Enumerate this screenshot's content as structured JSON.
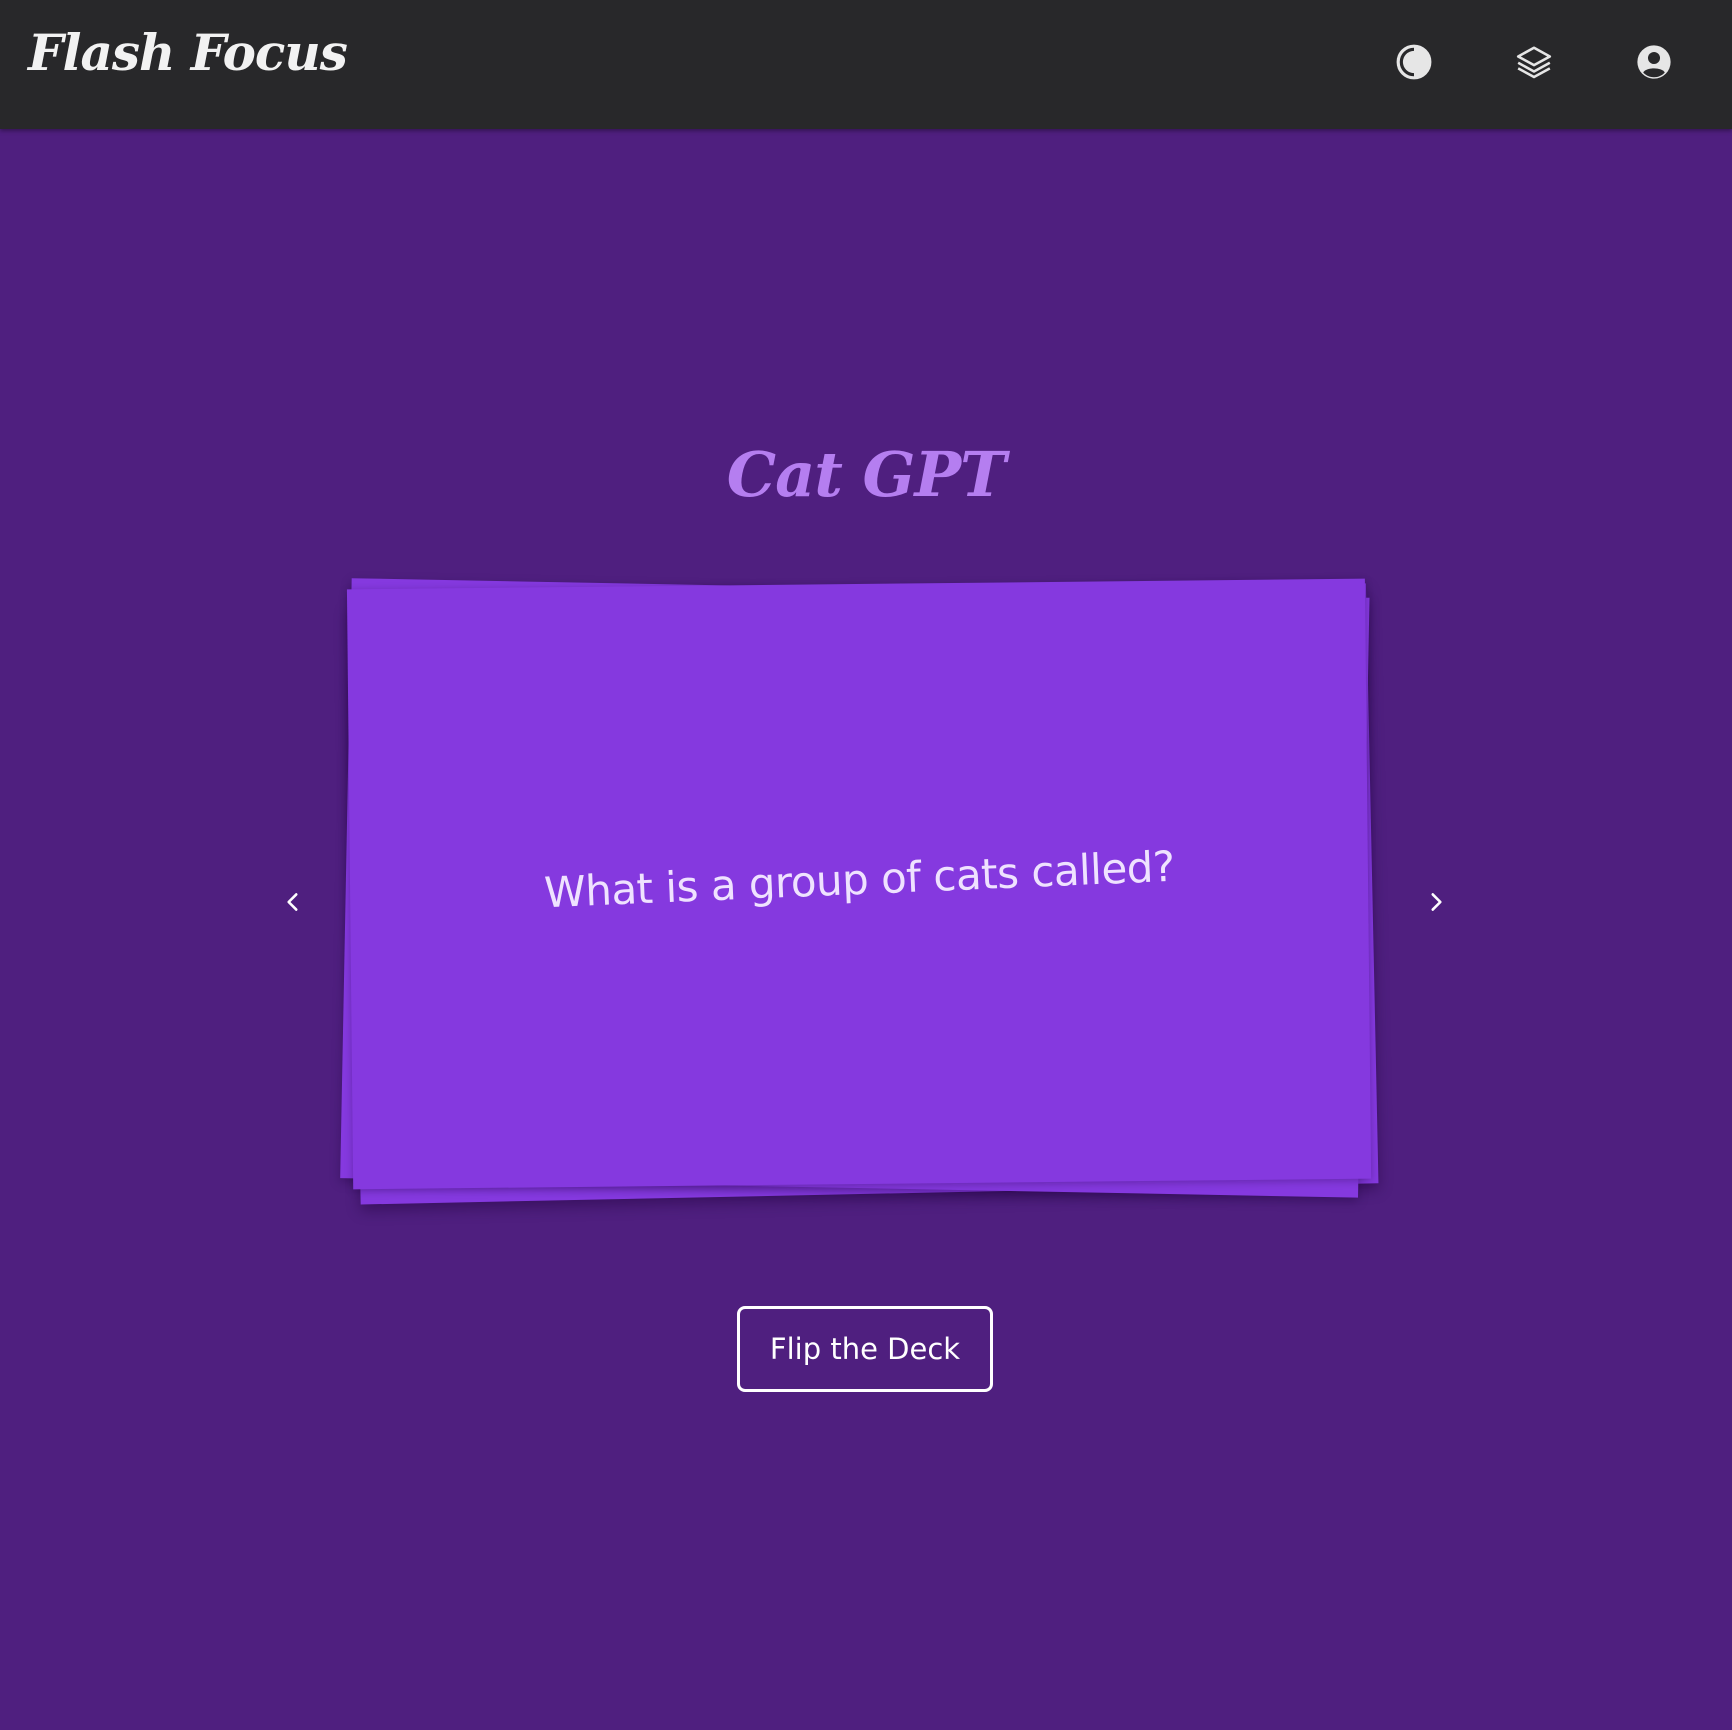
{
  "app": {
    "brand": "Flash Focus"
  },
  "nav": {
    "icons": [
      "contrast-icon",
      "layers-icon",
      "user-icon"
    ]
  },
  "deck": {
    "title": "Cat GPT",
    "current_card": {
      "side": "question",
      "text": "What is a group of cats called?"
    },
    "flip_label": "Flip the Deck"
  },
  "colors": {
    "topbar": "#28282a",
    "background": "#4f1f7f",
    "card": "#8539df",
    "deck_title": "#b57ef0",
    "card_text": "#efe2ff"
  }
}
